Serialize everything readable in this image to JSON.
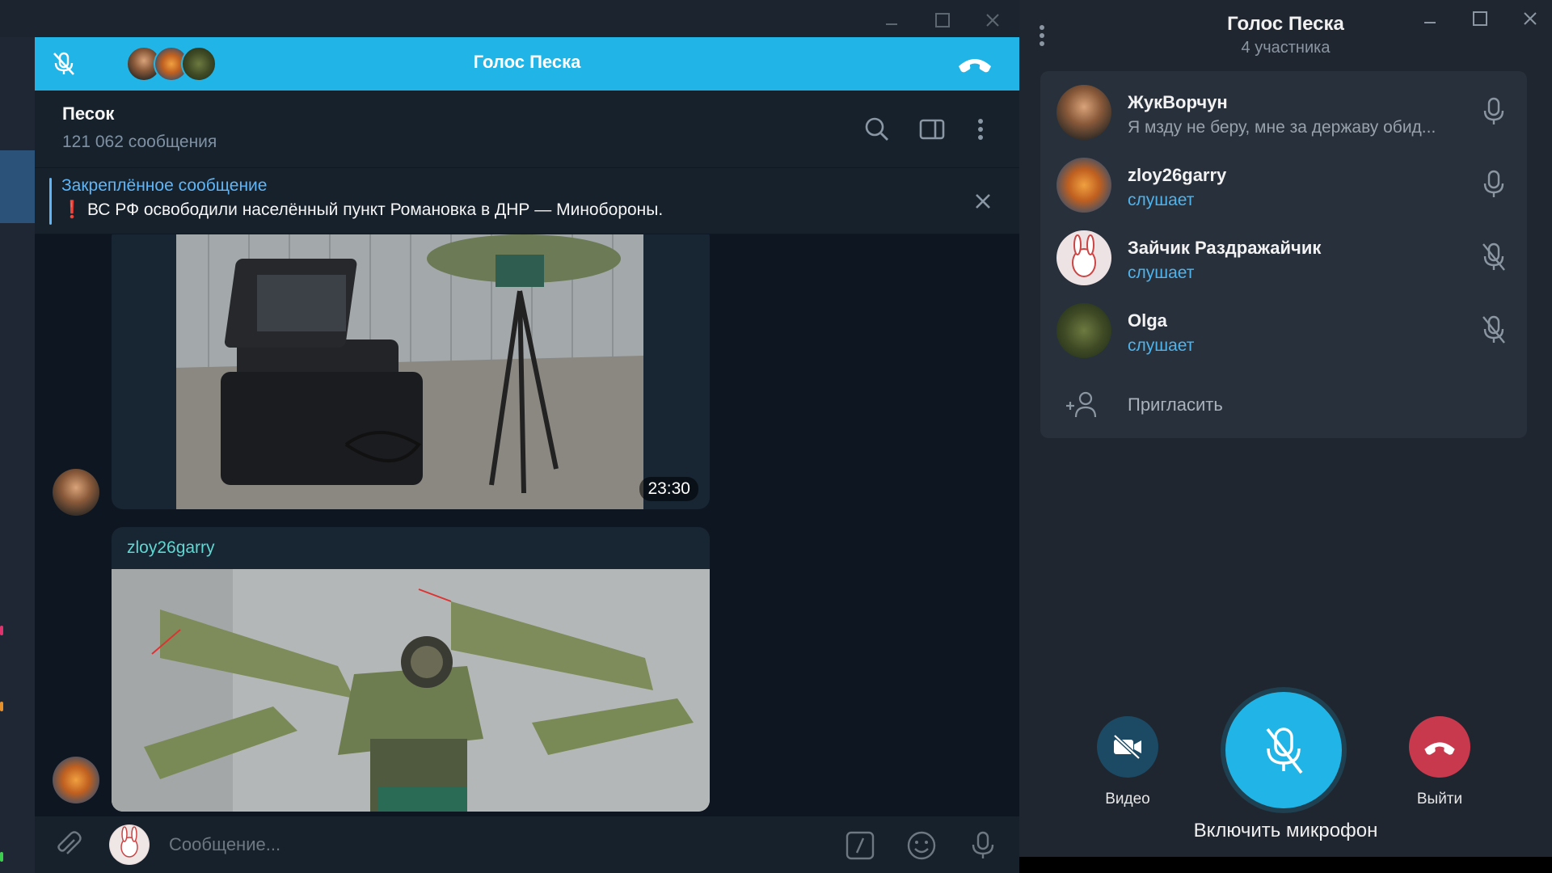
{
  "chat": {
    "call_bar_title": "Голос Песка",
    "chat_name": "Песок",
    "chat_subtitle": "121 062 сообщения",
    "pinned_title": "Закреплённое сообщение",
    "pinned_text": "❗ ВС РФ освободили населённый пункт Романовка в ДНР — Минобороны.",
    "message1_time": "23:30",
    "message2_author": "zloy26garry",
    "composer_placeholder": "Сообщение..."
  },
  "voice_chat": {
    "title": "Голос Песка",
    "subtitle": "4 участника",
    "participants": [
      {
        "name": "ЖукВорчун",
        "status": "Я мзду не беру, мне за державу обид...",
        "mic": "mic-icon"
      },
      {
        "name": "zloy26garry",
        "status": "слушает",
        "mic": "mic-icon"
      },
      {
        "name": "Зайчик Раздражайчик",
        "status": "слушает",
        "mic": "mic-muted-icon"
      },
      {
        "name": "Olga",
        "status": "слушает",
        "mic": "mic-muted-icon"
      }
    ],
    "invite_label": "Пригласить",
    "video_label": "Видео",
    "leave_label": "Выйти",
    "mic_toggle_label": "Включить микрофон"
  },
  "colors": {
    "accent": "#20b5e6",
    "link": "#5eb5f7",
    "author": "#5fd8d2",
    "listening": "#4fb3ec",
    "leave": "#c8394d",
    "video_btn": "#1c4a64"
  }
}
